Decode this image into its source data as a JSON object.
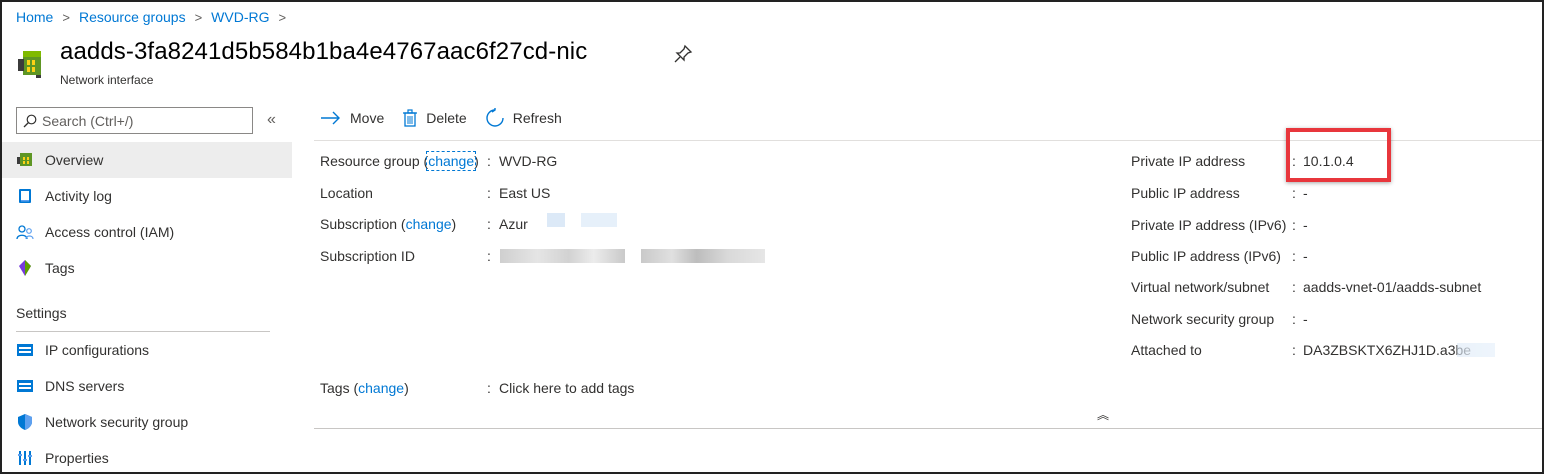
{
  "breadcrumb": {
    "items": [
      "Home",
      "Resource groups",
      "WVD-RG"
    ],
    "separator": ">"
  },
  "resource": {
    "title": "aadds-3fa8241d5b584b1ba4e4767aac6f27cd-nic",
    "type": "Network interface"
  },
  "sidebar": {
    "search_placeholder": "Search (Ctrl+/)",
    "collapse_glyph": "«",
    "items": [
      {
        "label": "Overview",
        "icon": "nic-icon",
        "active": true
      },
      {
        "label": "Activity log",
        "icon": "activity-log-icon"
      },
      {
        "label": "Access control (IAM)",
        "icon": "iam-icon"
      },
      {
        "label": "Tags",
        "icon": "tag-icon"
      }
    ],
    "settings_header": "Settings",
    "settings_items": [
      {
        "label": "IP configurations",
        "icon": "ip-config-icon"
      },
      {
        "label": "DNS servers",
        "icon": "dns-icon"
      },
      {
        "label": "Network security group",
        "icon": "shield-icon"
      },
      {
        "label": "Properties",
        "icon": "properties-icon"
      }
    ]
  },
  "toolbar": {
    "move_label": "Move",
    "delete_label": "Delete",
    "refresh_label": "Refresh"
  },
  "essentials": {
    "left": {
      "resource_group_label": "Resource group",
      "change_label": "change",
      "resource_group_value": "WVD-RG",
      "location_label": "Location",
      "location_value": "East US",
      "subscription_label": "Subscription",
      "subscription_value": "Azur",
      "subscription_id_label": "Subscription ID",
      "tags_label": "Tags",
      "tags_value": "Click here to add tags"
    },
    "right": {
      "private_ip_label": "Private IP address",
      "private_ip_value": "10.1.0.4",
      "public_ip_label": "Public IP address",
      "public_ip_value": "-",
      "private_ipv6_label": "Private IP address (IPv6)",
      "private_ipv6_value": "-",
      "public_ipv6_label": "Public IP address (IPv6)",
      "public_ipv6_value": "-",
      "vnet_label": "Virtual network/subnet",
      "vnet_value": "aadds-vnet-01/aadds-subnet",
      "nsg_label": "Network security group",
      "nsg_value": "-",
      "attached_label": "Attached to",
      "attached_value": "DA3ZBSKTX6ZHJ1D.a3be"
    },
    "colon": ":",
    "collapse_glyph": "︽"
  },
  "colors": {
    "link": "#0078d4",
    "highlight": "#e8363c",
    "active_nav_bg": "#ededed"
  }
}
